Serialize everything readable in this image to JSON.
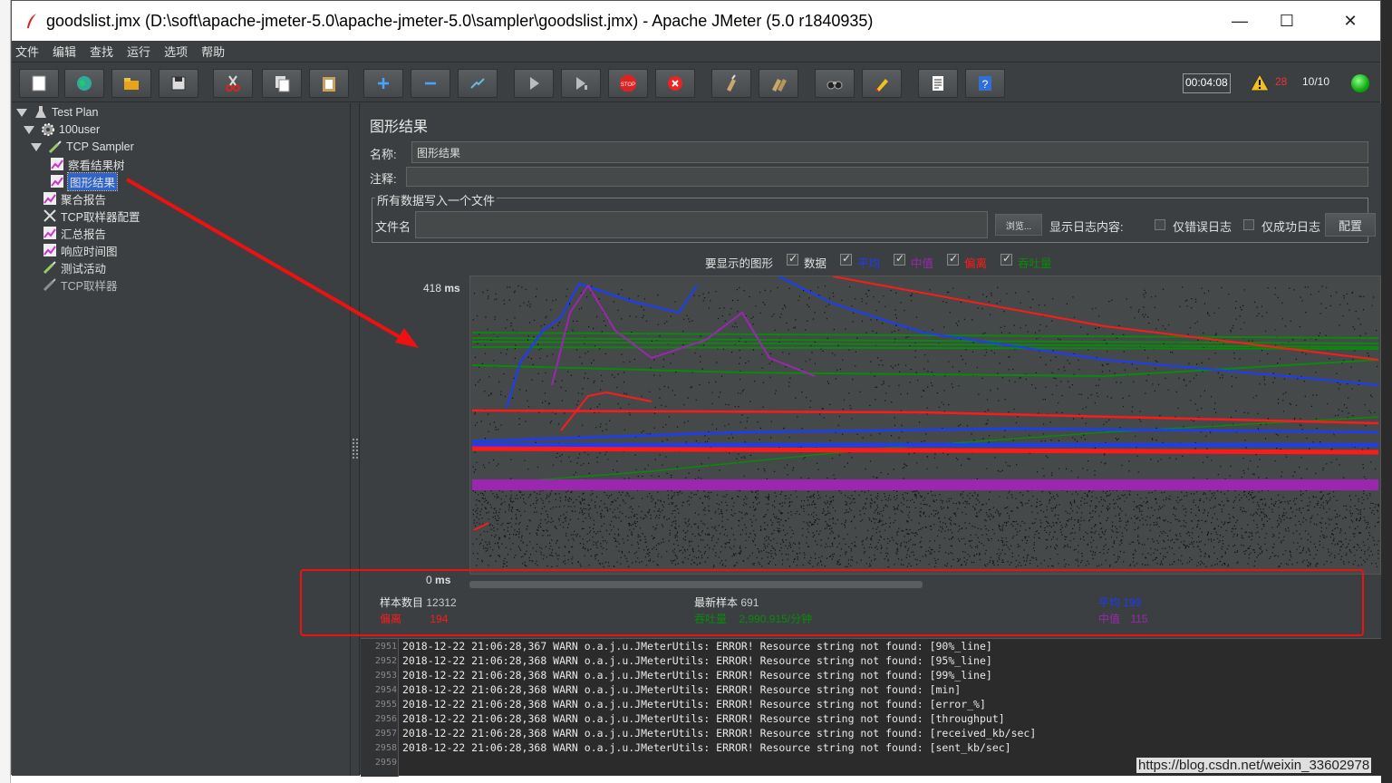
{
  "window": {
    "title": "goodslist.jmx (D:\\soft\\apache-jmeter-5.0\\apache-jmeter-5.0\\sampler\\goodslist.jmx) - Apache JMeter (5.0 r1840935)",
    "minimize": "—",
    "maximize": "☐",
    "close": "✕"
  },
  "menu": [
    "文件",
    "编辑",
    "查找",
    "运行",
    "选项",
    "帮助"
  ],
  "toolbar": {
    "timer": "00:04:08",
    "error_count": "28",
    "threads": "10/10"
  },
  "tree": [
    {
      "label": "Test Plan",
      "icon": "flask-icon"
    },
    {
      "label": "100user",
      "icon": "gear-icon"
    },
    {
      "label": "TCP Sampler",
      "icon": "pipette-icon"
    },
    {
      "label": "察看结果树",
      "icon": "graph-icon"
    },
    {
      "label": "图形结果",
      "icon": "graph-icon",
      "selected": true
    },
    {
      "label": "聚合报告",
      "icon": "graph-icon"
    },
    {
      "label": "TCP取样器配置",
      "icon": "tools-icon"
    },
    {
      "label": "汇总报告",
      "icon": "graph-icon"
    },
    {
      "label": "响应时间图",
      "icon": "graph-icon"
    },
    {
      "label": "测试活动",
      "icon": "pipette-icon"
    },
    {
      "label": "TCP取样器",
      "icon": "pipette-icon"
    }
  ],
  "panel": {
    "title": "图形结果",
    "name_label": "名称:",
    "name_value": "图形结果",
    "comment_label": "注释:",
    "file_group": "所有数据写入一个文件",
    "file_label": "文件名",
    "browse": "浏览...",
    "log_display": "显示日志内容:",
    "errors_only": "仅错误日志",
    "success_only": "仅成功日志",
    "configure": "配置",
    "display_graphs": "要显示的图形",
    "graph_options": [
      {
        "label": "数据",
        "color": "#e0e0e0"
      },
      {
        "label": "平均",
        "color": "#1a3cff"
      },
      {
        "label": "中值",
        "color": "#9b27b0"
      },
      {
        "label": "偏离",
        "color": "#ff1a1a"
      },
      {
        "label": "吞吐量",
        "color": "#0a8a0a"
      }
    ],
    "y_max": "418",
    "y_min": "0",
    "y_unit": "ms"
  },
  "stats": {
    "samples_label": "样本数目",
    "samples_value": "12312",
    "latest_label": "最新样本",
    "latest_value": "691",
    "average_label": "平均",
    "average_value": "199",
    "deviation_label": "偏离",
    "deviation_value": "194",
    "throughput_label": "吞吐量",
    "throughput_value": "2,990.915/分钟",
    "median_label": "中值",
    "median_value": "115"
  },
  "log": {
    "lines": [
      {
        "no": "2951",
        "text": "2018-12-22 21:06:28,367 WARN o.a.j.u.JMeterUtils: ERROR! Resource string not found: [90%_line]"
      },
      {
        "no": "2952",
        "text": "2018-12-22 21:06:28,368 WARN o.a.j.u.JMeterUtils: ERROR! Resource string not found: [95%_line]"
      },
      {
        "no": "2953",
        "text": "2018-12-22 21:06:28,368 WARN o.a.j.u.JMeterUtils: ERROR! Resource string not found: [99%_line]"
      },
      {
        "no": "2954",
        "text": "2018-12-22 21:06:28,368 WARN o.a.j.u.JMeterUtils: ERROR! Resource string not found: [min]"
      },
      {
        "no": "2955",
        "text": "2018-12-22 21:06:28,368 WARN o.a.j.u.JMeterUtils: ERROR! Resource string not found: [error_%]"
      },
      {
        "no": "2956",
        "text": "2018-12-22 21:06:28,368 WARN o.a.j.u.JMeterUtils: ERROR! Resource string not found: [throughput]"
      },
      {
        "no": "2957",
        "text": "2018-12-22 21:06:28,368 WARN o.a.j.u.JMeterUtils: ERROR! Resource string not found: [received_kb/sec]"
      },
      {
        "no": "2958",
        "text": "2018-12-22 21:06:28,368 WARN o.a.j.u.JMeterUtils: ERROR! Resource string not found: [sent_kb/sec]"
      },
      {
        "no": "2959",
        "text": ""
      }
    ]
  },
  "watermark": "https://blog.csdn.net/weixin_33602978"
}
